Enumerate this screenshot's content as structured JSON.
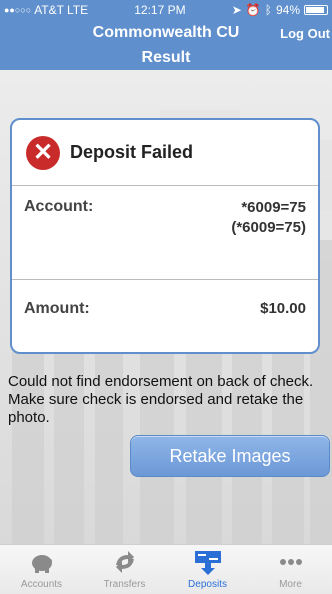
{
  "status_bar": {
    "carrier": "AT&T",
    "network": "LTE",
    "time": "12:17 PM",
    "battery": "94%",
    "battery_level": 0.94
  },
  "header": {
    "title": "Commonwealth CU",
    "logout_label": "Log Out",
    "subtitle": "Result"
  },
  "result": {
    "title": "Deposit Failed",
    "account_label": "Account:",
    "account_value_1": "*6009=75",
    "account_value_2": "(*6009=75)",
    "amount_label": "Amount:",
    "amount_value": "$10.00"
  },
  "message": "Could not find endorsement on back of check. Make sure check is endorsed and retake the photo.",
  "actions": {
    "retake_label": "Retake Images"
  },
  "tabs": [
    {
      "label": "Accounts",
      "icon": "piggy-bank-icon",
      "active": false
    },
    {
      "label": "Transfers",
      "icon": "transfer-arrows-icon",
      "active": false
    },
    {
      "label": "Deposits",
      "icon": "deposit-check-icon",
      "active": true
    },
    {
      "label": "More",
      "icon": "more-dots-icon",
      "active": false
    }
  ],
  "colors": {
    "brand": "#5f8fcc",
    "error": "#c92a2a",
    "active_tab": "#2b6fd6"
  }
}
